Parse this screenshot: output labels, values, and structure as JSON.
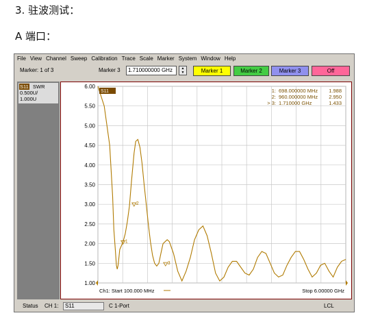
{
  "document": {
    "heading": "3. 驻波测试：",
    "subheading": "A 端口："
  },
  "menu": [
    "File",
    "View",
    "Channel",
    "Sweep",
    "Calibration",
    "Trace",
    "Scale",
    "Marker",
    "System",
    "Window",
    "Help"
  ],
  "marker_bar": {
    "count_label": "Marker: 1 of 3",
    "active_label": "Marker 3",
    "frequency_value": "1.710000000 GHz",
    "buttons": [
      {
        "label": "Marker 1",
        "color": "#ffff00"
      },
      {
        "label": "Marker 2",
        "color": "#44cc44"
      },
      {
        "label": "Marker 3",
        "color": "#9090ee"
      },
      {
        "label": "Off",
        "color": "#ff6699"
      }
    ]
  },
  "trace_panel": {
    "tag": "S11",
    "format": "SWR",
    "scale": "0.500U/",
    "reference": "1.000U"
  },
  "chart_data": {
    "type": "line",
    "trace_label": "S11",
    "trace_color": "#b07a00",
    "ylim": [
      1.0,
      6.0
    ],
    "y_ticks": [
      "6.00",
      "5.50",
      "5.00",
      "4.50",
      "4.00",
      "3.50",
      "3.00",
      "2.50",
      "2.00",
      "1.50",
      "1.00"
    ],
    "xlim_mhz": [
      100,
      6000
    ],
    "grid": true,
    "x_divisions": 10,
    "start_label": "Ch1: Start  100.000 MHz",
    "stop_label": "Stop  6.00000 GHz",
    "marker_readouts": [
      {
        "id": "1:",
        "frequency": "698.000000 MHz",
        "value": "1.988"
      },
      {
        "id": "2:",
        "frequency": "960.000000 MHz",
        "value": "2.950"
      },
      {
        "id": "> 3:",
        "frequency": "1.710000 GHz",
        "value": "1.433"
      }
    ],
    "markers": [
      {
        "name": "1",
        "x": 698,
        "y": 1.988
      },
      {
        "name": "2",
        "x": 960,
        "y": 2.95
      },
      {
        "name": "3",
        "x": 1710,
        "y": 1.433
      }
    ],
    "series": [
      {
        "x": [
          100,
          250,
          380,
          450,
          480,
          510,
          540,
          560,
          580,
          620,
          660,
          700,
          750,
          800,
          850,
          900,
          960,
          1000,
          1050,
          1100,
          1150,
          1200,
          1250,
          1300,
          1350,
          1400,
          1450,
          1500,
          1550,
          1600,
          1650,
          1700,
          1750,
          1800,
          1900,
          2000,
          2100,
          2200,
          2300,
          2400,
          2500,
          2600,
          2700,
          2800,
          2900,
          3000,
          3100,
          3200,
          3300,
          3400,
          3500,
          3600,
          3700,
          3800,
          3900,
          4000,
          4100,
          4200,
          4300,
          4400,
          4500,
          4600,
          4700,
          4800,
          4900,
          5000,
          5100,
          5200,
          5300,
          5400,
          5500,
          5600,
          5700,
          5800,
          5900,
          6000
        ],
        "y": [
          6.0,
          5.5,
          4.5,
          3.2,
          2.35,
          1.9,
          1.45,
          1.35,
          1.45,
          1.85,
          1.95,
          2.05,
          2.25,
          2.55,
          2.95,
          3.6,
          4.3,
          4.6,
          4.65,
          4.45,
          4.05,
          3.5,
          3.0,
          2.5,
          2.05,
          1.7,
          1.5,
          1.43,
          1.5,
          1.75,
          2.0,
          2.05,
          2.1,
          2.05,
          1.75,
          1.3,
          1.05,
          1.3,
          1.65,
          2.1,
          2.35,
          2.45,
          2.2,
          1.75,
          1.25,
          1.05,
          1.15,
          1.4,
          1.55,
          1.55,
          1.4,
          1.25,
          1.2,
          1.35,
          1.65,
          1.8,
          1.75,
          1.5,
          1.25,
          1.15,
          1.2,
          1.45,
          1.65,
          1.8,
          1.8,
          1.6,
          1.35,
          1.15,
          1.25,
          1.45,
          1.5,
          1.3,
          1.15,
          1.4,
          1.55,
          1.6
        ]
      }
    ]
  },
  "status_bar": {
    "status": "Status",
    "channel_label": "CH 1:",
    "channel_value": "S11",
    "port": "C  1-Port",
    "lcl": "LCL"
  }
}
